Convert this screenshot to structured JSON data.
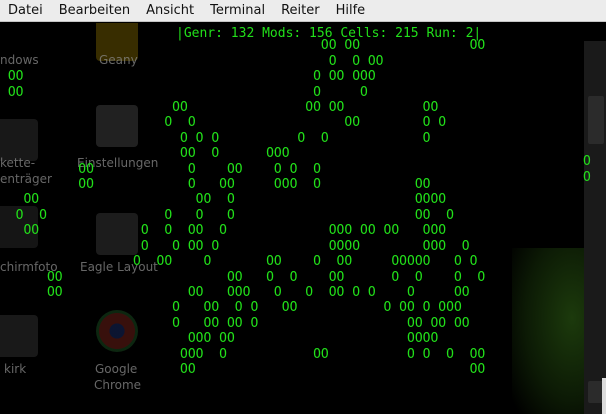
{
  "menubar": {
    "items": [
      "Datei",
      "Bearbeiten",
      "Ansicht",
      "Terminal",
      "Reiter",
      "Hilfe"
    ]
  },
  "status_line": "|Genr: 132 Mods: 156 Cells: 215 Run: 2|",
  "grid_rows": [
    "",
    "                                         OO OO              OO",
    "                                          O  O OO",
    " OO                                     O OO OOO",
    " OO                                     O     O",
    "                      OO               OO OO          OO",
    "                     O  O                   OO        O O",
    "                       O O O          O  O            O",
    "                       OO  O      OOO",
    "          OO            O    OO    O O  O",
    "          OO            O   OO     OOO  O            OO",
    "   OO                    OO  O                       OOOO",
    "  O  O               O   O   O                       OO  O",
    "   OO             O  O  OO  O             OOO OO OO   OOO",
    "                  O   O OO O              OOOO        OOO  O",
    "                 O  OO    O       OO    O  OO     OOOOO   O O",
    "      OO                     OO   O  O    OO      O  O    O  O",
    "      OO                OO   OOO   O   O  OO O O    O     OO",
    "                      O   OO  O O   OO           O OO O OOO",
    "                      O   OO OO O                   OO OO OO",
    "                        OOO OO                      OOOO",
    "                       OOO  O           OO          O O  O  OO",
    "                       OO                                   OO"
  ],
  "desktop_labels": [
    "ndows",
    "Geany",
    "kette-",
    "enträger",
    "Einstellungen",
    "chirmfoto",
    "Eagle Layout",
    "kirk",
    "Google",
    "Chrome"
  ],
  "right_edge": [
    "O",
    "O"
  ]
}
